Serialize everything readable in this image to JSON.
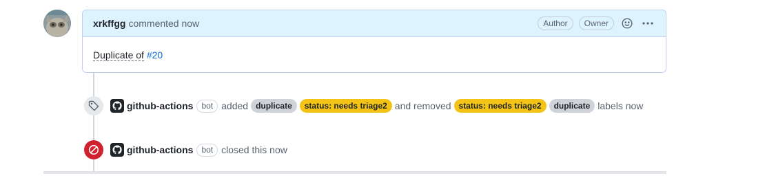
{
  "comment": {
    "author": "xrkffgg",
    "action": "commented now",
    "badges": [
      "Author",
      "Owner"
    ],
    "body_text": "Duplicate of",
    "body_link": "#20"
  },
  "events": {
    "labels": {
      "actor": "github-actions",
      "bot": "bot",
      "added_word": "added",
      "added": [
        {
          "name": "duplicate",
          "color": "#cfd3d7"
        },
        {
          "name": "status: needs triage2",
          "color": "#f3c316"
        }
      ],
      "removed_word": "and removed",
      "removed": [
        {
          "name": "status: needs triage2",
          "color": "#f3c316"
        },
        {
          "name": "duplicate",
          "color": "#cfd3d7"
        }
      ],
      "suffix": "labels now"
    },
    "closed": {
      "actor": "github-actions",
      "bot": "bot",
      "text": "closed this now"
    }
  },
  "icons": [
    "avatar",
    "smiley-icon",
    "kebab-icon",
    "tag-icon",
    "github-mark-icon",
    "closed-circle-icon"
  ],
  "colors": {
    "accent": "#0969da",
    "closed": "#cf222e",
    "header_bg": "#ddf4ff"
  }
}
